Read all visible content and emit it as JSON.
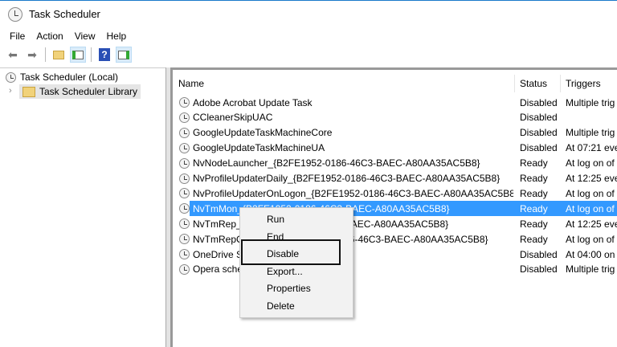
{
  "window": {
    "title": "Task Scheduler"
  },
  "menu": [
    "File",
    "Action",
    "View",
    "Help"
  ],
  "toolbar": {
    "icons": [
      "back-arrow-icon",
      "forward-arrow-icon",
      "up-folder-icon",
      "show-hide-console-tree-icon",
      "help-icon",
      "show-hide-action-pane-icon"
    ]
  },
  "tree": {
    "root": "Task Scheduler (Local)",
    "library": "Task Scheduler Library"
  },
  "table": {
    "headers": {
      "name": "Name",
      "status": "Status",
      "triggers": "Triggers"
    },
    "rows": [
      {
        "name": "Adobe Acrobat Update Task",
        "status": "Disabled",
        "triggers": "Multiple trig"
      },
      {
        "name": "CCleanerSkipUAC",
        "status": "Disabled",
        "triggers": ""
      },
      {
        "name": "GoogleUpdateTaskMachineCore",
        "status": "Disabled",
        "triggers": "Multiple trig"
      },
      {
        "name": "GoogleUpdateTaskMachineUA",
        "status": "Disabled",
        "triggers": "At 07:21 ever"
      },
      {
        "name": "NvNodeLauncher_{B2FE1952-0186-46C3-BAEC-A80AA35AC5B8}",
        "status": "Ready",
        "triggers": "At log on of"
      },
      {
        "name": "NvProfileUpdaterDaily_{B2FE1952-0186-46C3-BAEC-A80AA35AC5B8}",
        "status": "Ready",
        "triggers": "At 12:25 ever"
      },
      {
        "name": "NvProfileUpdaterOnLogon_{B2FE1952-0186-46C3-BAEC-A80AA35AC5B8}",
        "status": "Ready",
        "triggers": "At log on of"
      },
      {
        "name": "NvTmMon_{B2FE1952-0186-46C3-BAEC-A80AA35AC5B8}",
        "status": "Ready",
        "triggers": "At log on of",
        "selected": true
      },
      {
        "name": "NvTmRep_{B2FE1952-0186-46C3-BAEC-A80AA35AC5B8}",
        "status": "Ready",
        "triggers": "At 12:25 ever"
      },
      {
        "name": "NvTmRepOnLogon_{B2FE1952-0186-46C3-BAEC-A80AA35AC5B8}",
        "status": "Ready",
        "triggers": "At log on of"
      },
      {
        "name": "OneDrive Standalone Update Task",
        "status": "Disabled",
        "triggers": "At 04:00 on"
      },
      {
        "name": "Opera scheduled Autoupdate 814",
        "status": "Disabled",
        "triggers": "Multiple trig"
      }
    ]
  },
  "context_menu": {
    "items": [
      "Run",
      "End",
      "Disable",
      "Export...",
      "Properties",
      "Delete"
    ],
    "highlighted": "Disable"
  },
  "colors": {
    "selection": "#3399ff",
    "title_border": "#1979ca"
  }
}
